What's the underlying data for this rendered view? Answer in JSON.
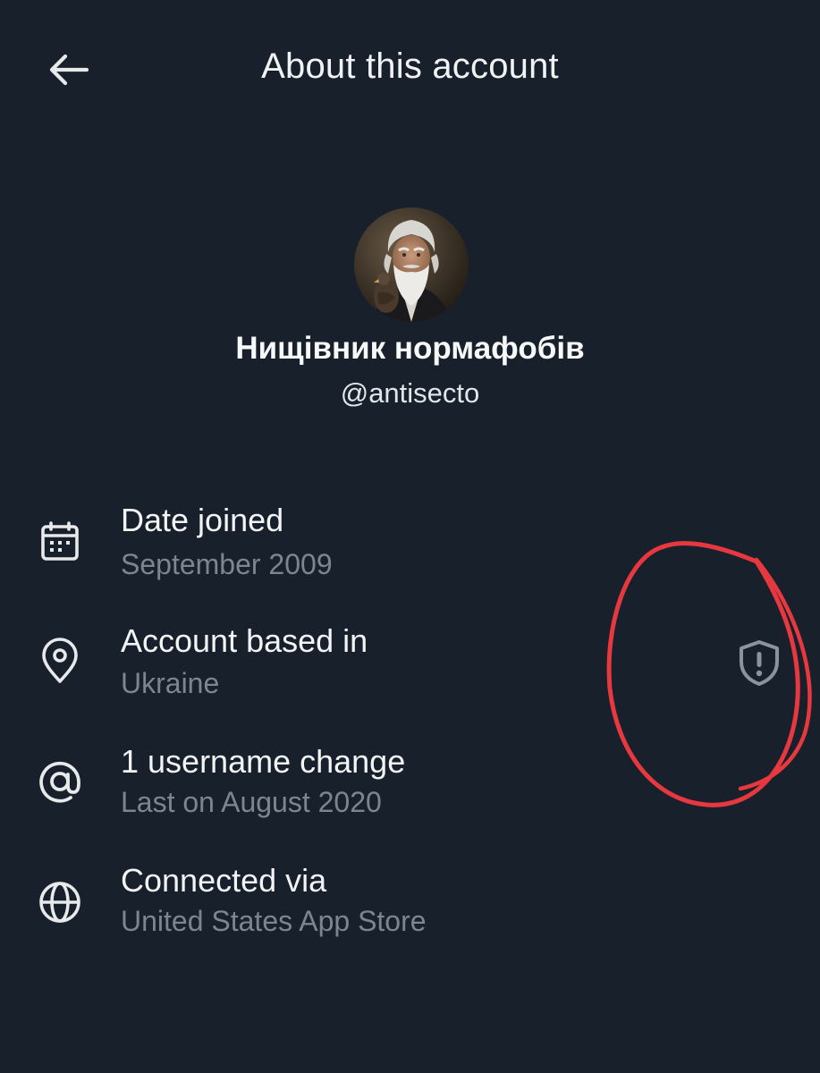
{
  "header": {
    "title": "About this account",
    "back_icon": "arrow-left-icon"
  },
  "profile": {
    "display_name": "Нищівник нормафобів",
    "handle": "@antisecto"
  },
  "details": [
    {
      "icon": "calendar-icon",
      "title": "Date joined",
      "subtitle": "September 2009"
    },
    {
      "icon": "location-pin-icon",
      "title": "Account based in",
      "subtitle": "Ukraine"
    },
    {
      "icon": "at-sign-icon",
      "title": "1 username change",
      "subtitle": "Last on August 2020"
    },
    {
      "icon": "globe-icon",
      "title": "Connected via",
      "subtitle": "United States App Store"
    }
  ],
  "indicator": {
    "icon": "shield-alert-icon"
  },
  "colors": {
    "background": "#17202b",
    "text_primary": "#f2f4f5",
    "text_secondary": "#7b8690",
    "annotation": "#e8383f"
  }
}
